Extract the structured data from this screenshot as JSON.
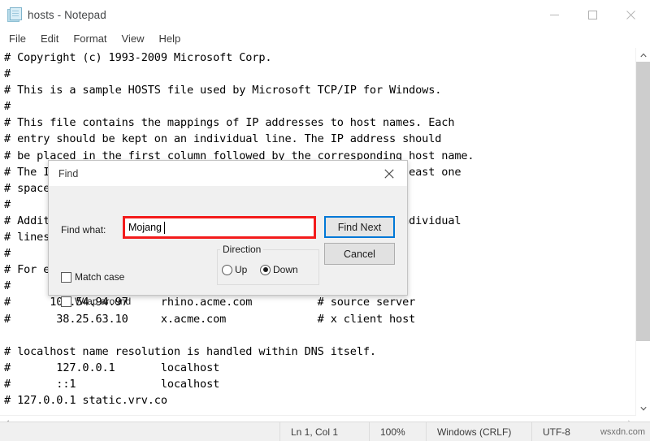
{
  "window": {
    "title": "hosts - Notepad",
    "icon": "notepad-icon",
    "controls": {
      "minimize": "minimize-icon",
      "maximize": "maximize-icon",
      "close": "close-icon"
    }
  },
  "menubar": {
    "items": [
      {
        "label": "File"
      },
      {
        "label": "Edit"
      },
      {
        "label": "Format"
      },
      {
        "label": "View"
      },
      {
        "label": "Help"
      }
    ]
  },
  "editor": {
    "text": "# Copyright (c) 1993-2009 Microsoft Corp.\n#\n# This is a sample HOSTS file used by Microsoft TCP/IP for Windows.\n#\n# This file contains the mappings of IP addresses to host names. Each\n# entry should be kept on an individual line. The IP address should\n# be placed in the first column followed by the corresponding host name.\n# The IP address and the host name should be separated by at least one\n# space.\n#\n# Additionally, comments (such as these) may be inserted on individual\n# lines or following the machine name denoted by a '#' symbol.\n#\n# For example:\n#\n#      102.54.94.97     rhino.acme.com          # source server\n#       38.25.63.10     x.acme.com              # x client host\n\n# localhost name resolution is handled within DNS itself.\n#\t127.0.0.1       localhost\n#\t::1             localhost\n# 127.0.0.1 static.vrv.co"
  },
  "scrollbars": {
    "vertical": {
      "up": "chevron-up-icon",
      "down": "chevron-down-icon"
    },
    "horizontal": {
      "left": "chevron-left-icon",
      "right": "chevron-right-icon"
    }
  },
  "statusbar": {
    "position": "Ln 1, Col 1",
    "zoom": "100%",
    "line_ending": "Windows (CRLF)",
    "encoding": "UTF-8",
    "watermark": "wsxdn.com"
  },
  "find_dialog": {
    "title": "Find",
    "close_icon": "close-icon",
    "find_what_label": "Find what:",
    "find_what_value": "Mojang",
    "find_what_placeholder": "",
    "buttons": {
      "find_next": "Find Next",
      "cancel": "Cancel"
    },
    "direction": {
      "legend": "Direction",
      "options": [
        {
          "label": "Up",
          "selected": false
        },
        {
          "label": "Down",
          "selected": true
        }
      ]
    },
    "checkboxes": [
      {
        "label": "Match case",
        "checked": false
      },
      {
        "label": "Wrap around",
        "checked": false
      }
    ],
    "highlight_color": "#f31b1b",
    "focus_color": "#0078d7"
  }
}
